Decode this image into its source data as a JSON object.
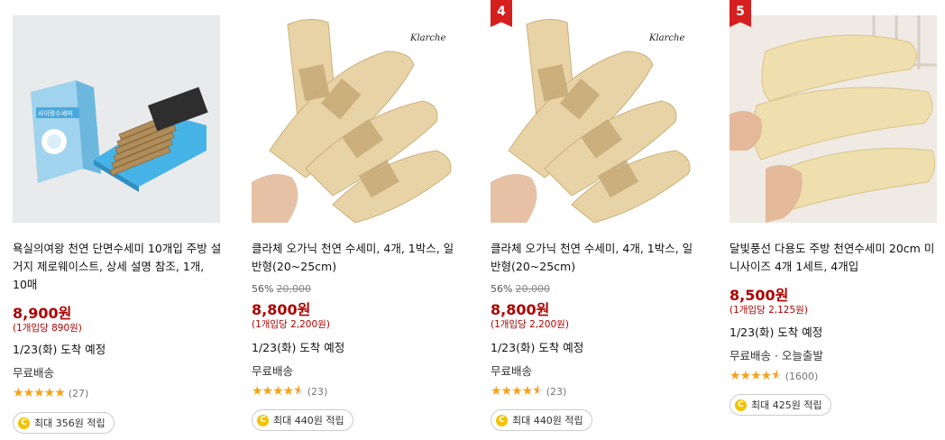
{
  "products": [
    {
      "title": "욕실의여왕 천연 단면수세미 10개입 주방 설거지 제로웨이스트, 상세 설명 참조, 1개, 10매",
      "rank": "",
      "discount_percent": "",
      "original_price": "",
      "price": "8,900원",
      "unit_price": "(1개입당 890원)",
      "arrival": "1/23(화) 도착 예정",
      "shipping": "무료배송",
      "rating": 5,
      "review_count": "(27)",
      "reward": "최대 356원 적립",
      "image_brand": "",
      "box_label": "사이랑수세미"
    },
    {
      "title": "클라체 오가닉 천연 수세미, 4개, 1박스, 일반형(20~25cm)",
      "rank": "",
      "discount_percent": "56%",
      "original_price": "20,000",
      "price": "8,800원",
      "unit_price": "(1개입당 2,200원)",
      "arrival": "1/23(화) 도착 예정",
      "shipping": "무료배송",
      "rating": 4.5,
      "review_count": "(23)",
      "reward": "최대 440원 적립",
      "image_brand": "Klarche"
    },
    {
      "title": "클라체 오가닉 천연 수세미, 4개, 1박스, 일반형(20~25cm)",
      "rank": "4",
      "discount_percent": "56%",
      "original_price": "20,000",
      "price": "8,800원",
      "unit_price": "(1개입당 2,200원)",
      "arrival": "1/23(화) 도착 예정",
      "shipping": "무료배송",
      "rating": 4.5,
      "review_count": "(23)",
      "reward": "최대 440원 적립",
      "image_brand": "Klarche"
    },
    {
      "title": "달빛풍선 다용도 주방 천연수세미 20cm 미니사이즈 4개 1세트, 4개입",
      "rank": "5",
      "discount_percent": "",
      "original_price": "",
      "price": "8,500원",
      "unit_price": "(1개입당 2,125원)",
      "arrival": "1/23(화) 도착 예정",
      "shipping": "무료배송 · 오늘출발",
      "rating": 4.5,
      "review_count": "(1600)",
      "reward": "최대 425원 적립",
      "image_brand": ""
    }
  ],
  "colors": {
    "price": "#ae0000",
    "rank_badge": "#d61f1f",
    "star": "#f7a21b",
    "coin": "#f2c300"
  }
}
